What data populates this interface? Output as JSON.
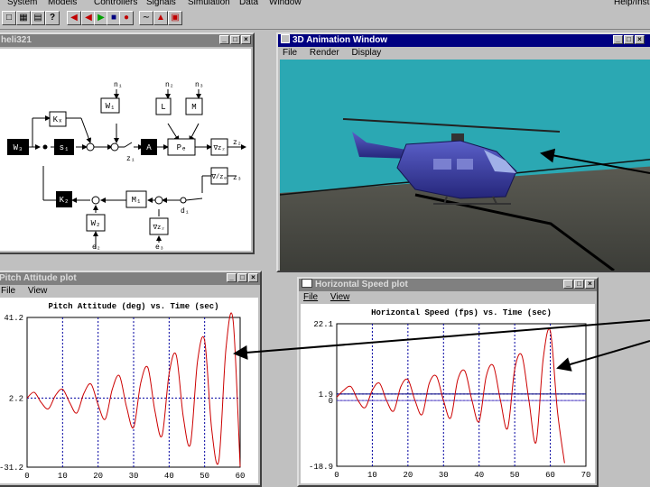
{
  "menubar": {
    "items": [
      "System",
      "Models",
      "Controllers",
      "Signals",
      "Simulation",
      "Data",
      "Window"
    ],
    "help": "Help/Inst"
  },
  "toolbar": {
    "buttons": [
      "open-icon",
      "save-icon",
      "print-icon",
      "help-icon",
      "rewind-icon",
      "play-icon",
      "step-icon",
      "stop-icon",
      "record-icon",
      "chart-icon",
      "probe-icon",
      "close-window-icon"
    ]
  },
  "block_window": {
    "title": "heli321",
    "blocks": {
      "Kx": "Kₓ",
      "W1": "W₁",
      "L": "L",
      "M": "M",
      "Wd": "W₃",
      "S1": "s₁",
      "A": "A",
      "Pe": "Pₑ",
      "Vz": "∇z₂",
      "Vzu": "∇/zₔ",
      "K2": "K₂",
      "M1": "M₁",
      "W2": "W₂",
      "Vz2": "∇z₂"
    },
    "signals": {
      "n1": "n₁",
      "n2": "n₂",
      "n3": "n₃",
      "z1": "z₁",
      "z2": "z₂",
      "z3": "z₃",
      "e2": "e₂",
      "e3": "e₃",
      "d1": "d₁",
      "d2": "d₂"
    }
  },
  "anim_window": {
    "title": "3D Animation Window",
    "menu": [
      "File",
      "Render",
      "Display"
    ]
  },
  "pitch_window": {
    "title": "Pitch Attitude plot",
    "menu": [
      "File",
      "View"
    ],
    "chart_data": {
      "type": "line",
      "title": "Pitch Attitude (deg) vs. Time (sec)",
      "xlabel": "",
      "ylabel": "",
      "x_ticks": [
        "0",
        "10",
        "20",
        "30",
        "40",
        "50",
        "60"
      ],
      "y_ticks": [
        "41.2",
        "2.2",
        "-31.2"
      ],
      "xlim": [
        0,
        60
      ],
      "ylim": [
        -31.2,
        41.2
      ],
      "grid": true,
      "series": [
        {
          "color": "#cc0000",
          "x": [
            0,
            2,
            4,
            6,
            8,
            10,
            12,
            14,
            16,
            18,
            20,
            22,
            24,
            26,
            28,
            30,
            32,
            34,
            36,
            38,
            40,
            42,
            44,
            46,
            48,
            50,
            52,
            54,
            56,
            58,
            60
          ],
          "values": [
            2.2,
            5,
            0,
            -3,
            3.5,
            6.5,
            0,
            -5,
            4.5,
            9,
            -1,
            -8,
            6.5,
            13,
            -2,
            -12,
            9.5,
            17,
            -4,
            -16,
            14,
            23,
            -7,
            -20,
            20,
            30,
            -13,
            -28,
            26,
            40,
            -31
          ]
        }
      ]
    }
  },
  "hspeed_window": {
    "title": "Horizontal Speed plot",
    "menu": [
      "File",
      "View"
    ],
    "chart_data": {
      "type": "line",
      "title": "Horizontal Speed (fps) vs. Time (sec)",
      "xlabel": "",
      "ylabel": "",
      "x_ticks": [
        "0",
        "10",
        "20",
        "30",
        "40",
        "50",
        "60",
        "70"
      ],
      "y_ticks": [
        "22.1",
        "1.9",
        "0",
        "-18.9"
      ],
      "xlim": [
        0,
        70
      ],
      "ylim": [
        -18.9,
        22.1
      ],
      "grid": true,
      "reference_lines": [
        {
          "y": 1.9,
          "color": "#000080"
        },
        {
          "y": 0,
          "color": "#6a5acd"
        }
      ],
      "series": [
        {
          "color": "#cc0000",
          "x": [
            0,
            2,
            4,
            6,
            8,
            10,
            12,
            14,
            16,
            18,
            20,
            22,
            24,
            26,
            28,
            30,
            32,
            34,
            36,
            38,
            40,
            42,
            44,
            46,
            48,
            50,
            52,
            54,
            56,
            58,
            60,
            62,
            64
          ],
          "values": [
            1,
            3,
            4,
            0,
            -2,
            3,
            5,
            0,
            -3,
            4,
            6,
            0,
            -4,
            5,
            7,
            0,
            -5,
            6,
            8.5,
            0,
            -6,
            7,
            10,
            0,
            -8,
            9,
            13,
            0,
            -12,
            12,
            20,
            -3,
            -18
          ]
        }
      ]
    }
  }
}
